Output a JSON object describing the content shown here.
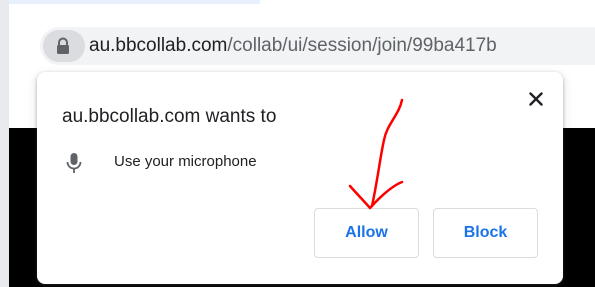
{
  "browser": {
    "address_bar": {
      "domain": "au.bbcollab.com",
      "path": "/collab/ui/session/join/99ba417b",
      "lock_icon": "lock-icon"
    }
  },
  "permission_prompt": {
    "title": "au.bbcollab.com wants to",
    "close_icon": "close-icon",
    "permission": {
      "icon": "microphone-icon",
      "label": "Use your microphone"
    },
    "buttons": {
      "allow_label": "Allow",
      "block_label": "Block"
    }
  },
  "annotation": {
    "type": "hand-drawn arrow",
    "color": "#ff0000",
    "target": "allow-button"
  },
  "colors": {
    "accent": "#1a73e8",
    "annotation": "#ff0000",
    "page_background": "#000000"
  }
}
